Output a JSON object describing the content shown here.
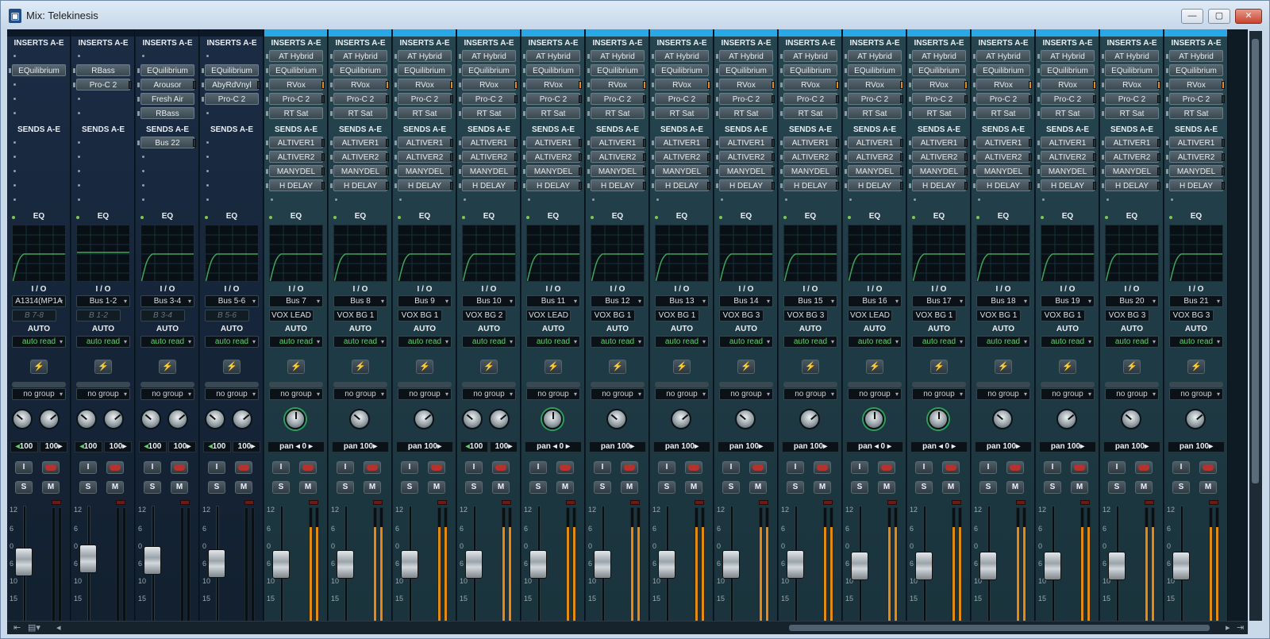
{
  "window": {
    "title": "Mix: Telekinesis",
    "icon": "sonar-app-icon"
  },
  "labels": {
    "inserts": "INSERTS A-E",
    "sends": "SENDS A-E",
    "eq": "EQ",
    "io": "I / O",
    "auto": "AUTO",
    "input_echo": "I",
    "solo": "S",
    "mute": "M",
    "pan": "pan",
    "bolt": "⚡"
  },
  "meter_color": "#e28a12",
  "fader_scale": [
    "12",
    "6",
    "0",
    "6",
    "10",
    "15"
  ],
  "strips": [
    {
      "kind": "midi",
      "inserts": [
        "",
        "EQuilibrium",
        "",
        "",
        ""
      ],
      "sends": [],
      "input": "A1314(MP1A",
      "output": "B 7-8",
      "auto": "auto read",
      "group": "no group",
      "pan": [
        "100",
        "100"
      ],
      "knobs": "stereo",
      "fader": 0.55,
      "meter": 0
    },
    {
      "kind": "midi",
      "inserts": [
        "",
        "RBass",
        "Pro-C 2",
        "",
        ""
      ],
      "sends": [],
      "input": "Bus 1-2",
      "output": "B 1-2",
      "auto": "auto read",
      "group": "no group",
      "pan": [
        "100",
        "100"
      ],
      "knobs": "stereo",
      "fader": 0.62,
      "meter": 0
    },
    {
      "kind": "midi",
      "inserts": [
        "",
        "EQuilibrium",
        "Arousor",
        "Fresh Air",
        "RBass"
      ],
      "sends": [
        "Bus 22"
      ],
      "input": "Bus 3-4",
      "output": "B 3-4",
      "auto": "auto read",
      "group": "no group",
      "pan": [
        "100",
        "100"
      ],
      "knobs": "stereo",
      "fader": 0.58,
      "meter": 0
    },
    {
      "kind": "midi",
      "inserts": [
        "",
        "EQuilibrium",
        "AbyRdVnyl",
        "Pro-C 2",
        ""
      ],
      "sends": [],
      "input": "Bus 5-6",
      "output": "B 5-6",
      "auto": "auto read",
      "group": "no group",
      "pan": [
        "100",
        "100"
      ],
      "knobs": "stereo",
      "fader": 0.52,
      "meter": 0
    },
    {
      "kind": "audio",
      "inserts": [
        "AT Hybrid",
        "EQuilibrium",
        "RVox",
        "Pro-C 2",
        "RT Sat"
      ],
      "sends": [
        "ALTIVER1",
        "ALTIVER2",
        "MANYDEL",
        "H DELAY"
      ],
      "input": "Bus 7",
      "output": "VOX LEAD",
      "auto": "auto read",
      "group": "no group",
      "pan": [
        "pan",
        "0"
      ],
      "knobs": "center",
      "fader": 0.5,
      "meter": 0.84
    },
    {
      "kind": "audio",
      "inserts": [
        "AT Hybrid",
        "EQuilibrium",
        "RVox",
        "Pro-C 2",
        "RT Sat"
      ],
      "sends": [
        "ALTIVER1",
        "ALTIVER2",
        "MANYDEL",
        "H DELAY"
      ],
      "input": "Bus 8",
      "output": "VOX BG 1",
      "auto": "auto read",
      "group": "no group",
      "pan": [
        "pan",
        "100"
      ],
      "knobs": "left",
      "fader": 0.5,
      "meter": 0.84
    },
    {
      "kind": "audio",
      "inserts": [
        "AT Hybrid",
        "EQuilibrium",
        "RVox",
        "Pro-C 2",
        "RT Sat"
      ],
      "sends": [
        "ALTIVER1",
        "ALTIVER2",
        "MANYDEL",
        "H DELAY"
      ],
      "input": "Bus 9",
      "output": "VOX BG 1",
      "auto": "auto read",
      "group": "no group",
      "pan": [
        "pan",
        "100"
      ],
      "knobs": "right",
      "fader": 0.5,
      "meter": 0.84
    },
    {
      "kind": "audio",
      "inserts": [
        "AT Hybrid",
        "EQuilibrium",
        "RVox",
        "Pro-C 2",
        "RT Sat"
      ],
      "sends": [
        "ALTIVER1",
        "ALTIVER2",
        "MANYDEL",
        "H DELAY"
      ],
      "input": "Bus 10",
      "output": "VOX BG 2",
      "auto": "auto read",
      "group": "no group",
      "pan": [
        "100",
        "100"
      ],
      "knobs": "stereo",
      "fader": 0.5,
      "meter": 0.84
    },
    {
      "kind": "audio",
      "inserts": [
        "AT Hybrid",
        "EQuilibrium",
        "RVox",
        "Pro-C 2",
        "RT Sat"
      ],
      "sends": [
        "ALTIVER1",
        "ALTIVER2",
        "MANYDEL",
        "H DELAY"
      ],
      "input": "Bus 11",
      "output": "VOX LEAD",
      "auto": "auto read",
      "group": "no group",
      "pan": [
        "pan",
        "0"
      ],
      "knobs": "center",
      "fader": 0.5,
      "meter": 0.84
    },
    {
      "kind": "audio",
      "inserts": [
        "AT Hybrid",
        "EQuilibrium",
        "RVox",
        "Pro-C 2",
        "RT Sat"
      ],
      "sends": [
        "ALTIVER1",
        "ALTIVER2",
        "MANYDEL",
        "H DELAY"
      ],
      "input": "Bus 12",
      "output": "VOX BG 1",
      "auto": "auto read",
      "group": "no group",
      "pan": [
        "pan",
        "100"
      ],
      "knobs": "left",
      "fader": 0.5,
      "meter": 0.84
    },
    {
      "kind": "audio",
      "inserts": [
        "AT Hybrid",
        "EQuilibrium",
        "RVox",
        "Pro-C 2",
        "RT Sat"
      ],
      "sends": [
        "ALTIVER1",
        "ALTIVER2",
        "MANYDEL",
        "H DELAY"
      ],
      "input": "Bus 13",
      "output": "VOX BG 1",
      "auto": "auto read",
      "group": "no group",
      "pan": [
        "pan",
        "100"
      ],
      "knobs": "right",
      "fader": 0.5,
      "meter": 0.84
    },
    {
      "kind": "audio",
      "inserts": [
        "AT Hybrid",
        "EQuilibrium",
        "RVox",
        "Pro-C 2",
        "RT Sat"
      ],
      "sends": [
        "ALTIVER1",
        "ALTIVER2",
        "MANYDEL",
        "H DELAY"
      ],
      "input": "Bus 14",
      "output": "VOX BG 3",
      "auto": "auto read",
      "group": "no group",
      "pan": [
        "pan",
        "100"
      ],
      "knobs": "left",
      "fader": 0.5,
      "meter": 0.84
    },
    {
      "kind": "audio",
      "inserts": [
        "AT Hybrid",
        "EQuilibrium",
        "RVox",
        "Pro-C 2",
        "RT Sat"
      ],
      "sends": [
        "ALTIVER1",
        "ALTIVER2",
        "MANYDEL",
        "H DELAY"
      ],
      "input": "Bus 15",
      "output": "VOX BG 3",
      "auto": "auto read",
      "group": "no group",
      "pan": [
        "pan",
        "100"
      ],
      "knobs": "right",
      "fader": 0.5,
      "meter": 0.84
    },
    {
      "kind": "audio",
      "inserts": [
        "AT Hybrid",
        "EQuilibrium",
        "RVox",
        "Pro-C 2",
        "RT Sat"
      ],
      "sends": [
        "ALTIVER1",
        "ALTIVER2",
        "MANYDEL",
        "H DELAY"
      ],
      "input": "Bus 16",
      "output": "VOX LEAD",
      "auto": "auto read",
      "group": "no group",
      "pan": [
        "pan",
        "0"
      ],
      "knobs": "center",
      "fader": 0.46,
      "meter": 0.84
    },
    {
      "kind": "audio",
      "inserts": [
        "AT Hybrid",
        "EQuilibrium",
        "RVox",
        "Pro-C 2",
        "RT Sat"
      ],
      "sends": [
        "ALTIVER1",
        "ALTIVER2",
        "MANYDEL",
        "H DELAY"
      ],
      "input": "Bus 17",
      "output": "VOX BG 1",
      "auto": "auto read",
      "group": "no group",
      "pan": [
        "pan",
        "0"
      ],
      "knobs": "center",
      "fader": 0.46,
      "meter": 0.84
    },
    {
      "kind": "audio",
      "inserts": [
        "AT Hybrid",
        "EQuilibrium",
        "RVox",
        "Pro-C 2",
        "RT Sat"
      ],
      "sends": [
        "ALTIVER1",
        "ALTIVER2",
        "MANYDEL",
        "H DELAY"
      ],
      "input": "Bus 18",
      "output": "VOX BG 1",
      "auto": "auto read",
      "group": "no group",
      "pan": [
        "pan",
        "100"
      ],
      "knobs": "left",
      "fader": 0.46,
      "meter": 0.84
    },
    {
      "kind": "audio",
      "inserts": [
        "AT Hybrid",
        "EQuilibrium",
        "RVox",
        "Pro-C 2",
        "RT Sat"
      ],
      "sends": [
        "ALTIVER1",
        "ALTIVER2",
        "MANYDEL",
        "H DELAY"
      ],
      "input": "Bus 19",
      "output": "VOX BG 1",
      "auto": "auto read",
      "group": "no group",
      "pan": [
        "pan",
        "100"
      ],
      "knobs": "right",
      "fader": 0.46,
      "meter": 0.84
    },
    {
      "kind": "audio",
      "inserts": [
        "AT Hybrid",
        "EQuilibrium",
        "RVox",
        "Pro-C 2",
        "RT Sat"
      ],
      "sends": [
        "ALTIVER1",
        "ALTIVER2",
        "MANYDEL",
        "H DELAY"
      ],
      "input": "Bus 20",
      "output": "VOX BG 3",
      "auto": "auto read",
      "group": "no group",
      "pan": [
        "pan",
        "100"
      ],
      "knobs": "left",
      "fader": 0.46,
      "meter": 0.84
    },
    {
      "kind": "audio",
      "inserts": [
        "AT Hybrid",
        "EQuilibrium",
        "RVox",
        "Pro-C 2",
        "RT Sat"
      ],
      "sends": [
        "ALTIVER1",
        "ALTIVER2",
        "MANYDEL",
        "H DELAY"
      ],
      "input": "Bus 21",
      "output": "VOX BG 3",
      "auto": "auto read",
      "group": "no group",
      "pan": [
        "pan",
        "100"
      ],
      "knobs": "right",
      "fader": 0.46,
      "meter": 0.84
    }
  ]
}
